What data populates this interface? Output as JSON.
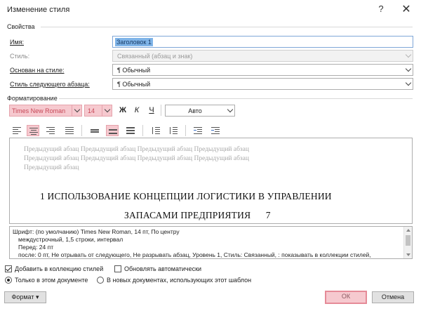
{
  "dialog": {
    "title": "Изменение стиля",
    "help_label": "?",
    "close_label": "✕"
  },
  "properties": {
    "section_label": "Свойства",
    "name_label": "Имя:",
    "name_value": "Заголовок 1",
    "style_type_label": "Стиль:",
    "style_type_value": "Связанный (абзац и знак)",
    "based_on_label": "Основан на стиле:",
    "based_on_value": "¶  Обычный",
    "next_style_label": "Стиль следующего абзаца:",
    "next_style_value": "¶  Обычный"
  },
  "formatting": {
    "section_label": "Форматирование",
    "font_name": "Times New Roman",
    "font_size": "14",
    "bold_label": "Ж",
    "italic_label": "К",
    "underline_label": "Ч",
    "color_value": "Авто"
  },
  "preview": {
    "prev_para_line1": "Предыдущий абзац Предыдущий абзац Предыдущий абзац Предыдущий абзац",
    "prev_para_line2": "Предыдущий абзац Предыдущий абзац Предыдущий абзац Предыдущий абзац",
    "prev_para_line3": "Предыдущий абзац",
    "heading_line1": "1 ИСПОЛЬЗОВАНИЕ КОНЦЕПЦИИ ЛОГИСТИКИ В УПРАВЛЕНИИ",
    "heading_line2": "ЗАПАСАМИ ПРЕДПРИЯТИЯ      7"
  },
  "description": {
    "line1": "Шрифт: (по умолчанию) Times New Roman, 14 пт, По центру",
    "line2": "междустрочный,  1,5 строки, интервал",
    "line3": "Перед:  24 пт",
    "line4": "после: 0 пт, Не отрывать от следующего, Не разрывать абзац, Уровень 1, Стиль: Связанный, : показывать в коллекции стилей,"
  },
  "options": {
    "add_to_gallery_label": "Добавить в коллекцию стилей",
    "add_to_gallery_checked": true,
    "auto_update_label": "Обновлять автоматически",
    "auto_update_checked": false,
    "only_this_doc_label": "Только в этом документе",
    "new_docs_label": "В новых документах, использующих этот шаблон"
  },
  "buttons": {
    "format_label": "Формат ▾",
    "ok_label": "ОК",
    "cancel_label": "Отмена"
  },
  "colors": {
    "highlight_pink": "#f6c9cf",
    "selection_blue": "#7fb4e8"
  }
}
